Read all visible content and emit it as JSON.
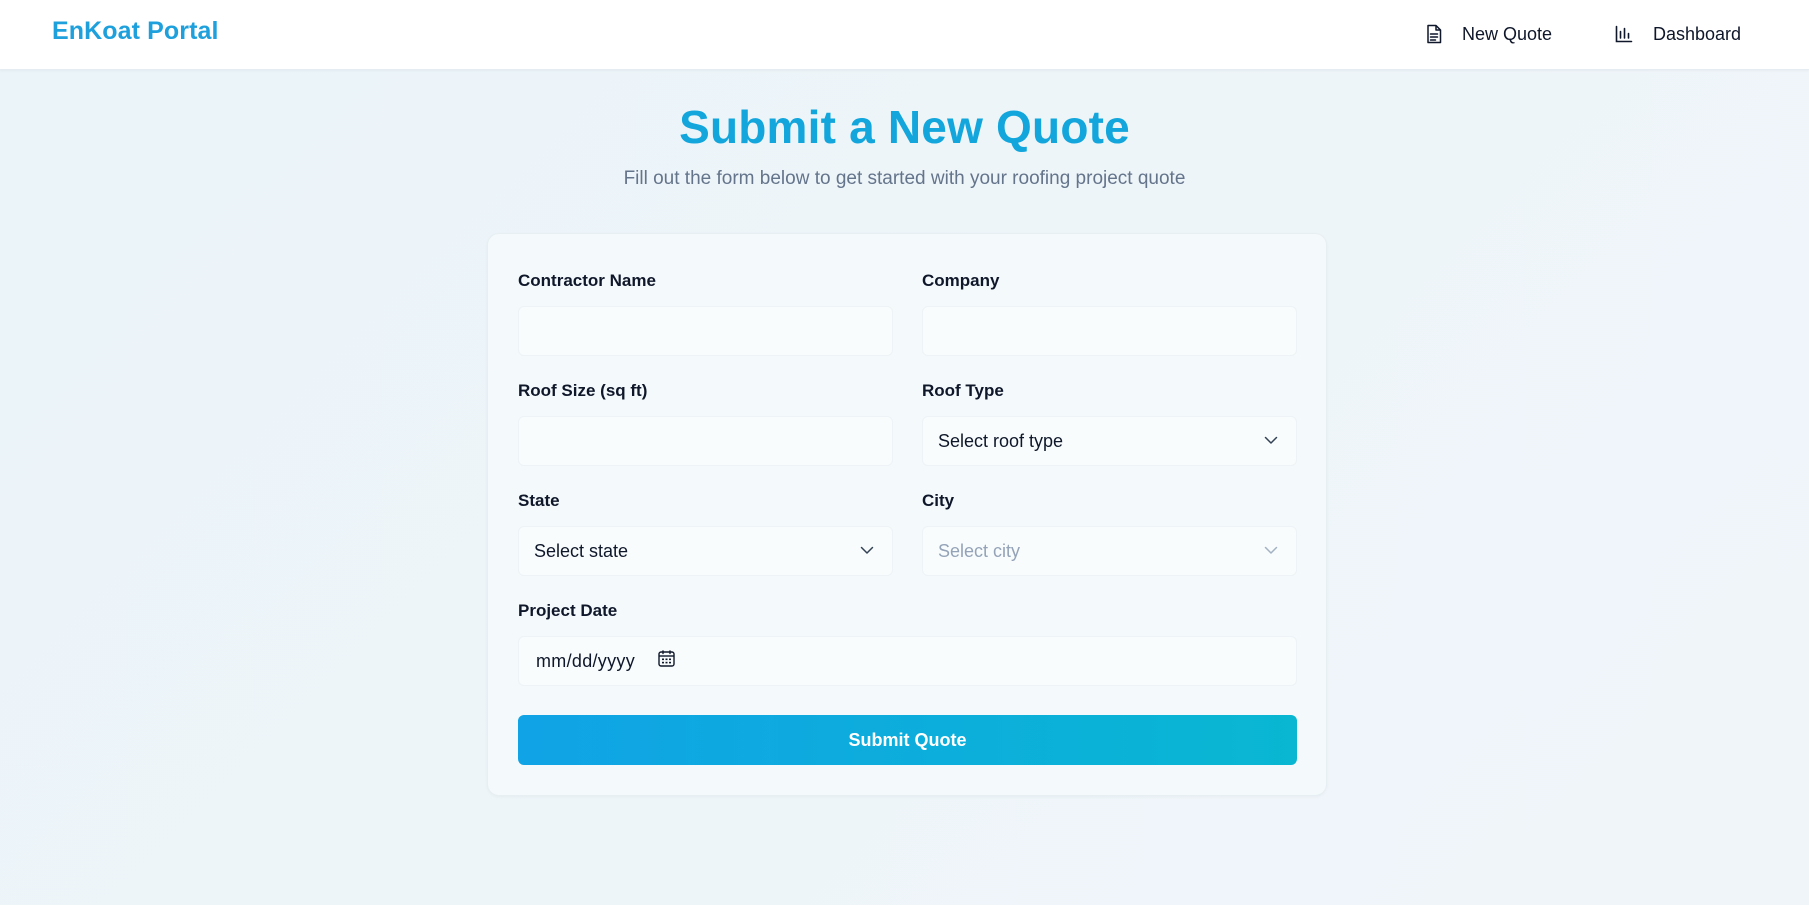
{
  "brand": {
    "name": "EnKoat Portal"
  },
  "nav": {
    "new_quote": {
      "label": "New Quote",
      "icon": "document-icon"
    },
    "dashboard": {
      "label": "Dashboard",
      "icon": "bar-chart-icon"
    }
  },
  "header": {
    "title": "Submit a New Quote",
    "subtitle": "Fill out the form below to get started with your roofing project quote"
  },
  "form": {
    "contractor_name": {
      "label": "Contractor Name",
      "value": ""
    },
    "company": {
      "label": "Company",
      "value": ""
    },
    "roof_size": {
      "label": "Roof Size (sq ft)",
      "value": ""
    },
    "roof_type": {
      "label": "Roof Type",
      "selected": "Select roof type"
    },
    "state": {
      "label": "State",
      "selected": "Select state"
    },
    "city": {
      "label": "City",
      "selected": "Select city",
      "disabled": true
    },
    "project_date": {
      "label": "Project Date",
      "placeholder": "mm/dd/yyyy"
    },
    "submit_label": "Submit Quote"
  },
  "colors": {
    "brand": "#1ea0dc",
    "title": "#12a6dc",
    "button_start": "#10a3e6",
    "button_end": "#09b7d2"
  }
}
